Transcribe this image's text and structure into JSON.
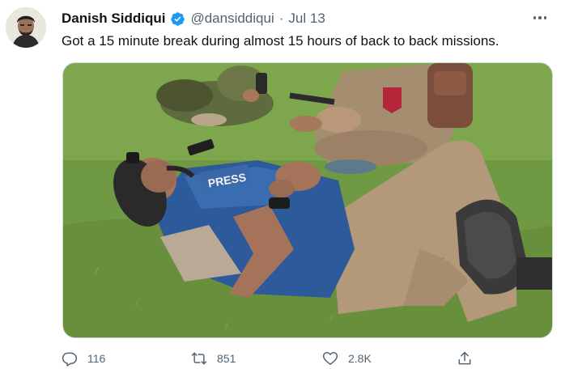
{
  "author": {
    "display_name": "Danish Siddiqui",
    "handle": "@dansiddiqui",
    "separator": "·",
    "date": "Jul 13",
    "verified": true
  },
  "tweet": {
    "text": "Got a 15 minute break during almost 15 hours of back to back missions."
  },
  "media": {
    "vest_label": "PRESS"
  },
  "actions": {
    "replies": "116",
    "retweets": "851",
    "likes": "2.8K"
  },
  "colors": {
    "text_primary": "#0f1419",
    "text_secondary": "#536471",
    "verified_blue": "#1d9bf0",
    "border": "#cfd9de"
  },
  "icons": {
    "avatar": "avatar",
    "verified": "verified-badge-icon",
    "more": "more-options-icon",
    "reply": "reply-icon",
    "retweet": "retweet-icon",
    "like": "heart-icon",
    "share": "share-icon"
  }
}
